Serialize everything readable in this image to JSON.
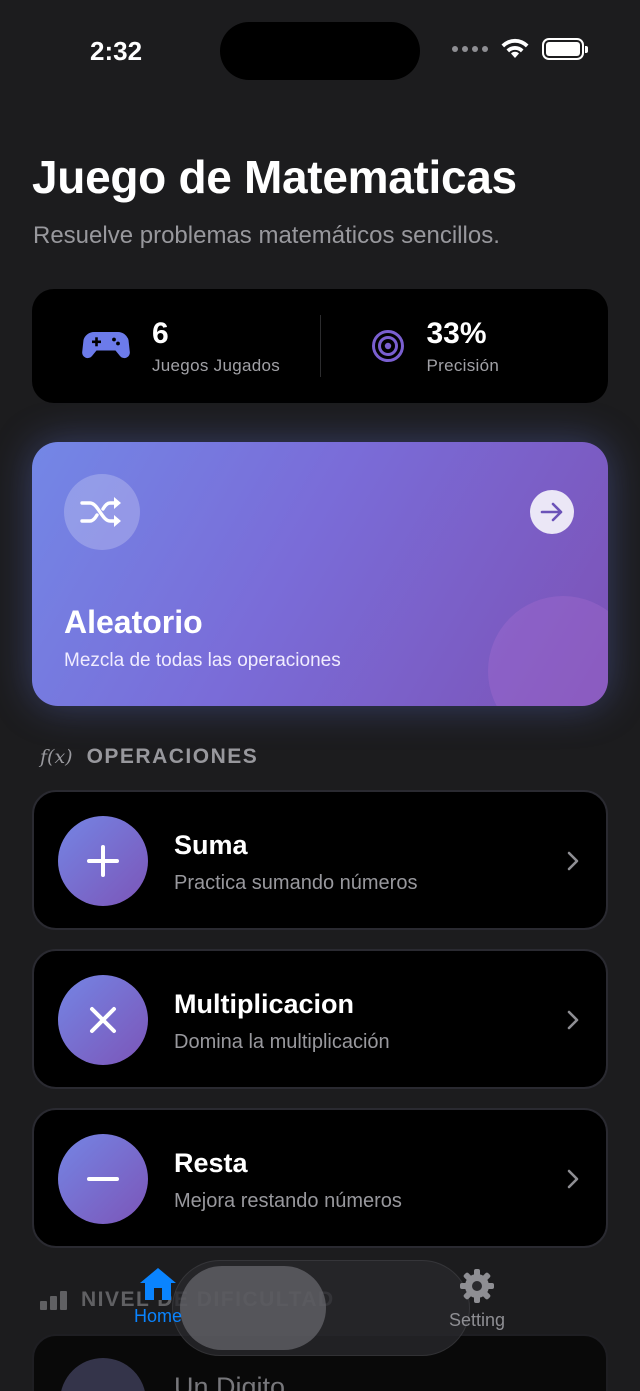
{
  "status_bar": {
    "time": "2:32"
  },
  "header": {
    "title": "Juego de Matematicas",
    "subtitle": "Resuelve problemas matemáticos sencillos."
  },
  "stats": {
    "games": {
      "value": "6",
      "label": "Juegos Jugados",
      "icon": "gamecontroller-icon"
    },
    "accuracy": {
      "value": "33%",
      "label": "Precisión",
      "icon": "target-icon"
    }
  },
  "random_card": {
    "title": "Aleatorio",
    "subtitle": "Mezcla de todas las operaciones",
    "icon": "shuffle-icon",
    "action_icon": "arrow-right-icon"
  },
  "operations_section": {
    "icon_text": "f(x)",
    "title": "OPERACIONES",
    "items": [
      {
        "title": "Suma",
        "subtitle": "Practica sumando números",
        "icon": "plus-icon"
      },
      {
        "title": "Multiplicacion",
        "subtitle": "Domina la multiplicación",
        "icon": "multiply-icon"
      },
      {
        "title": "Resta",
        "subtitle": "Mejora restando números",
        "icon": "minus-icon"
      }
    ]
  },
  "level_section": {
    "title": "NIVEL DE DIFICULTAD",
    "items": [
      {
        "title": "Un Digito"
      }
    ]
  },
  "tab_bar": {
    "tabs": [
      {
        "label": "Home",
        "icon": "house-icon",
        "selected": true
      },
      {
        "label": "Setting",
        "icon": "gear-icon",
        "selected": false
      }
    ]
  },
  "colors": {
    "background": "#1c1c1e",
    "card": "#000000",
    "accent": "#0a84ff",
    "gradient_start": "#7387e6",
    "gradient_end": "#7c52b6",
    "secondary_text": "#98989d"
  }
}
